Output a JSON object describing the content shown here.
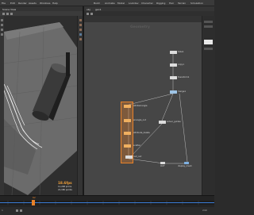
{
  "menubar": {
    "items": [
      "File",
      "Edit",
      "Render",
      "Assets",
      "Windows",
      "Help"
    ],
    "desktop_tabs": [
      "Build",
      "Animate",
      "Model",
      "Lookdev",
      "Character",
      "Rigging",
      "Hair",
      "Terrain",
      "Simulation"
    ]
  },
  "viewport": {
    "tab_label": "Scene View",
    "fps": "18.6fps",
    "stats_line1": "11,208 prims",
    "stats_line2": "21,180 points"
  },
  "network": {
    "tabs": [
      "obj",
      "geo1"
    ],
    "title": "Geometry",
    "nodes": [
      {
        "label": "tube1"
      },
      {
        "label": "copy1"
      },
      {
        "label": "transform1"
      },
      {
        "label": "merge1"
      },
      {
        "label": "attribwrangle"
      },
      {
        "label": "wrangle_out"
      },
      {
        "label": "attribute_delete"
      },
      {
        "label": "scatter"
      },
      {
        "label": "null_out"
      },
      {
        "label": "solver_guides"
      },
      {
        "label": "OUT"
      },
      {
        "label": "display_mesh"
      }
    ]
  },
  "timeline": {
    "frame": "62",
    "start": "1",
    "end": "240"
  },
  "colors": {
    "accent": "#e8822a",
    "selected_node": "#f0a040",
    "timeline_blue": "#3a7bd5"
  }
}
